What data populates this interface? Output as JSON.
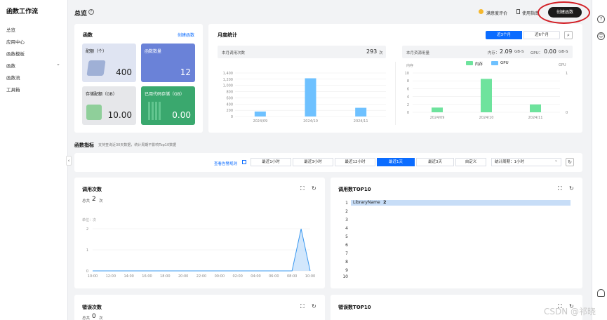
{
  "sidebar": {
    "title": "函数工作流",
    "items": [
      "总览",
      "应用中心",
      "函数模板",
      "函数",
      "函数流",
      "工具箱"
    ]
  },
  "header": {
    "title": "总览",
    "help": "?",
    "feedback": "满意度评价",
    "docs": "使用指南",
    "create": "创建函数"
  },
  "right_icons": [
    "?",
    "☺"
  ],
  "functions": {
    "title": "函数",
    "create_link": "创建函数",
    "tiles": [
      {
        "label": "配额（个）",
        "value": "400"
      },
      {
        "label": "函数数量",
        "value": "12"
      },
      {
        "label": "存储配额（GB）",
        "value": "10.00"
      },
      {
        "label": "已用代码存储（GB）",
        "value": "0.00"
      }
    ]
  },
  "monthly": {
    "title": "月度统计",
    "range_3m": "近3个月",
    "range_6m": "近6个月",
    "calls_label": "本月调用次数",
    "calls_value": "293",
    "calls_unit": "次",
    "res_label": "本月资源用量",
    "mem_label": "内存：",
    "mem_value": "2.09",
    "mem_unit": "GB-S",
    "gpu_label": "GPU：",
    "gpu_value": "0.00",
    "gpu_unit": "GB-S",
    "left_axis": "内存",
    "right_axis": "GPU",
    "legend_mem": "内存",
    "legend_gpu": "GPU"
  },
  "metrics": {
    "title": "函数指标",
    "subtitle": "支持查询近30天数据，统计周期不影响Top10数据",
    "alarm_link": "查看告警规则",
    "ranges": [
      "最近1小时",
      "最近3小时",
      "最近12小时",
      "最近1天",
      "最近3天",
      "自定义"
    ],
    "period": "统计周期：1小时"
  },
  "calls_card": {
    "title": "调用次数",
    "total_label": "总共",
    "total_value": "2",
    "total_unit": "次",
    "unit_label": "单位：次"
  },
  "top10_card": {
    "title": "调用数TOP10",
    "item_name": "LibraryName",
    "item_value": "2",
    "ranks": [
      "1",
      "2",
      "3",
      "4",
      "5",
      "6",
      "7",
      "8",
      "9",
      "10"
    ]
  },
  "errors_card": {
    "title": "错误次数",
    "total_label": "总共",
    "total_value": "0",
    "total_unit": "次"
  },
  "errtop_card": {
    "title": "错误数TOP10"
  },
  "watermark": "CSDN @祁晓",
  "colors": {
    "accent": "#0b6cff",
    "mem": "#6ee39d",
    "gpu": "#6ec1ff",
    "highlight": "#d21f26"
  },
  "chart_data": [
    {
      "type": "bar",
      "categories": [
        "2024/09",
        "2024/10",
        "2024/11"
      ],
      "values": [
        160,
        1230,
        280
      ],
      "ylim": [
        0,
        1400
      ],
      "yticks": [
        0,
        200,
        400,
        600,
        800,
        1000,
        1200,
        1400
      ]
    },
    {
      "type": "bar",
      "categories": [
        "2024/09",
        "2024/10",
        "2024/11"
      ],
      "series": [
        {
          "name": "内存",
          "values": [
            1.2,
            8.5,
            2
          ]
        }
      ],
      "ylim": [
        0,
        10
      ],
      "yticks": [
        0,
        2,
        4,
        6,
        8,
        10
      ],
      "y2ticks": [
        0,
        1
      ]
    },
    {
      "type": "area",
      "x": [
        "10:00",
        "12:00",
        "14:00",
        "16:00",
        "18:00",
        "20:00",
        "22:00",
        "00:00",
        "02:00",
        "04:00",
        "06:00",
        "08:00",
        "10:00"
      ],
      "values": [
        0,
        0,
        0,
        0,
        0,
        0,
        0,
        0,
        0,
        0,
        0,
        0,
        0
      ],
      "peak": {
        "x": "09:00",
        "y": 2
      },
      "ylim": [
        0,
        2
      ],
      "yticks": [
        0,
        1,
        2
      ]
    }
  ]
}
